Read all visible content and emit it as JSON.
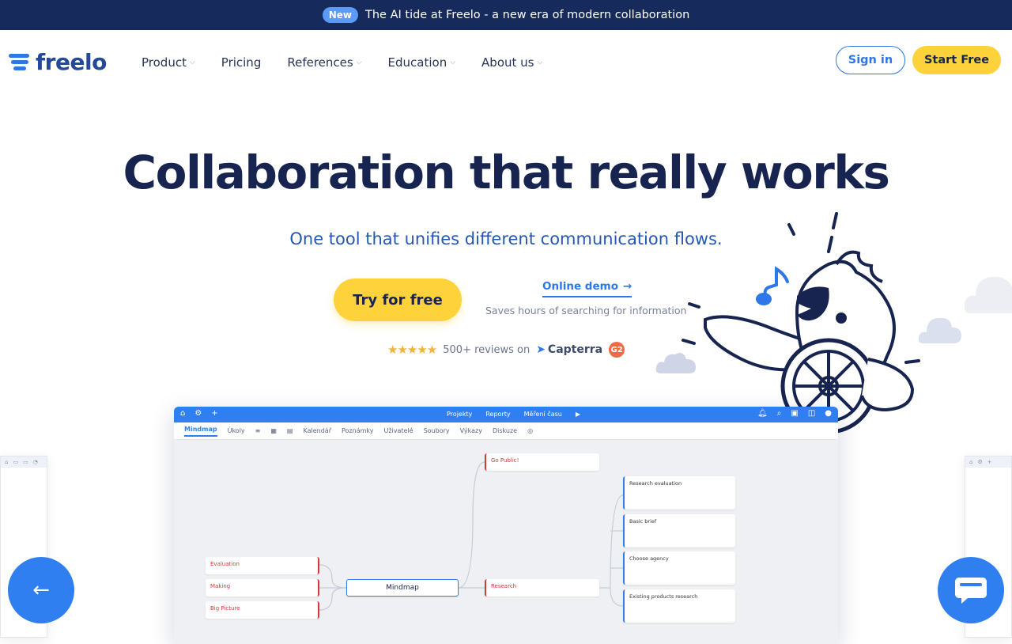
{
  "announcement": {
    "badge": "New",
    "text": "The AI tide at Freelo - a new era of modern collaboration"
  },
  "header": {
    "logo_text": "freelo",
    "menu": [
      {
        "label": "Product",
        "has_dropdown": true
      },
      {
        "label": "Pricing",
        "has_dropdown": false
      },
      {
        "label": "References",
        "has_dropdown": true
      },
      {
        "label": "Education",
        "has_dropdown": true
      },
      {
        "label": "About us",
        "has_dropdown": true
      }
    ],
    "sign_in": "Sign in",
    "start_free": "Start Free"
  },
  "hero": {
    "title": "Collaboration that really works",
    "subtitle": "One tool that unifies different communication flows.",
    "cta_primary": "Try for free",
    "cta_secondary": "Online demo",
    "cta_secondary_note": "Saves hours of searching for information",
    "reviews": {
      "rating_stars": 5,
      "text": "500+ reviews on",
      "capterra": "Capterra",
      "g2": "G2"
    }
  },
  "app_preview": {
    "topbar_center": [
      "Projekty",
      "Reporty",
      "Měření času"
    ],
    "tabs": [
      "Mindmap",
      "Úkoly",
      "Kalendář",
      "Poznámky",
      "Uživatelé",
      "Soubory",
      "Výkazy",
      "Diskuze"
    ],
    "mindmap": {
      "center": "Mindmap",
      "left": [
        "Evaluation",
        "Making",
        "Big Picture"
      ],
      "middle": [
        "Go Public!",
        "Research"
      ],
      "right": [
        "Research evaluation",
        "Basic brief",
        "Choose agency",
        "Existing products research"
      ]
    }
  },
  "colors": {
    "brand_blue": "#2d77e8",
    "navy": "#16244f",
    "yellow": "#fdd23b",
    "announce_bg": "#172a5c"
  },
  "icons": {
    "prev": "arrow-left-icon",
    "chat": "chat-bubble-icon"
  }
}
